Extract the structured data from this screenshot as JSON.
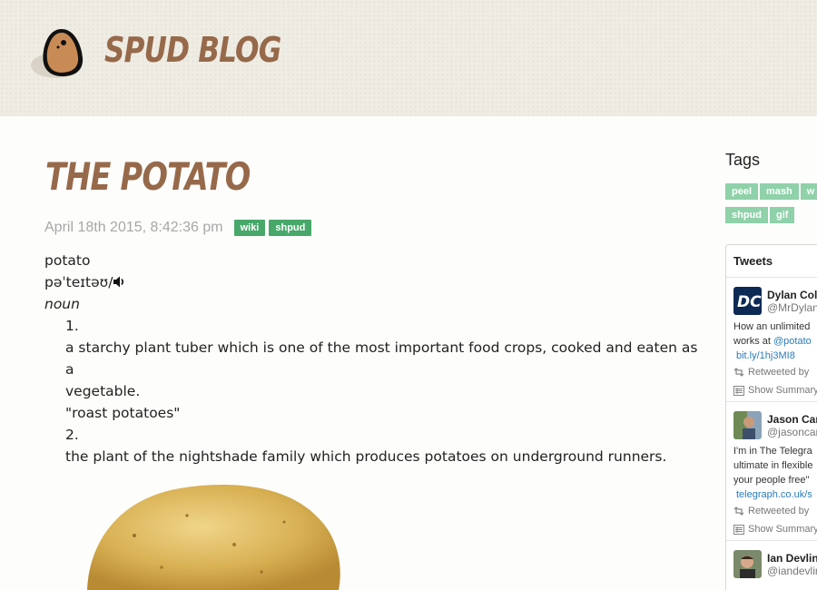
{
  "site": {
    "title": "Spud Blog"
  },
  "post": {
    "title": "The Potato",
    "date": "April 18th 2015, 8:42:36 pm",
    "tags": [
      "wiki",
      "shpud"
    ],
    "word": "potato",
    "pronunciation": "pəˈteɪtəʊ/",
    "pos": "noun",
    "definitions": [
      {
        "num": "1.",
        "text": "a starchy plant tuber which is one of the most important food crops, cooked and eaten as a",
        "text2": "vegetable.",
        "example": "\"roast potatoes\""
      },
      {
        "num": "2.",
        "text": "the plant of the nightshade family which produces potatoes on underground runners."
      }
    ]
  },
  "sidebar": {
    "tags_heading": "Tags",
    "tags": [
      "peel",
      "mash",
      "w",
      "shpud",
      "gif"
    ],
    "tweets_heading": "Tweets",
    "tweets": [
      {
        "name": "Dylan Coll",
        "handle": "@MrDylan",
        "line1": "How an unlimited",
        "line2_prefix": "works at ",
        "line2_link": "@potato",
        "link": "bit.ly/1hj3MI8",
        "retweeted": "Retweeted by",
        "summary": "Show Summary"
      },
      {
        "name": "Jason Cart",
        "handle": "@jasoncar",
        "line1": "I'm in The Telegra",
        "line2": "ultimate in flexible",
        "line3": "your people free\"",
        "link": "telegraph.co.uk/s",
        "retweeted": "Retweeted by",
        "summary": "Show Summary"
      },
      {
        "name": "Ian Devlin",
        "handle": "@iandevlin"
      }
    ]
  },
  "colors": {
    "brand_brown": "#96694a",
    "tag_green": "#47a86a",
    "tag_light_green": "#8fd1a9",
    "link_blue": "#2b7bb9"
  }
}
